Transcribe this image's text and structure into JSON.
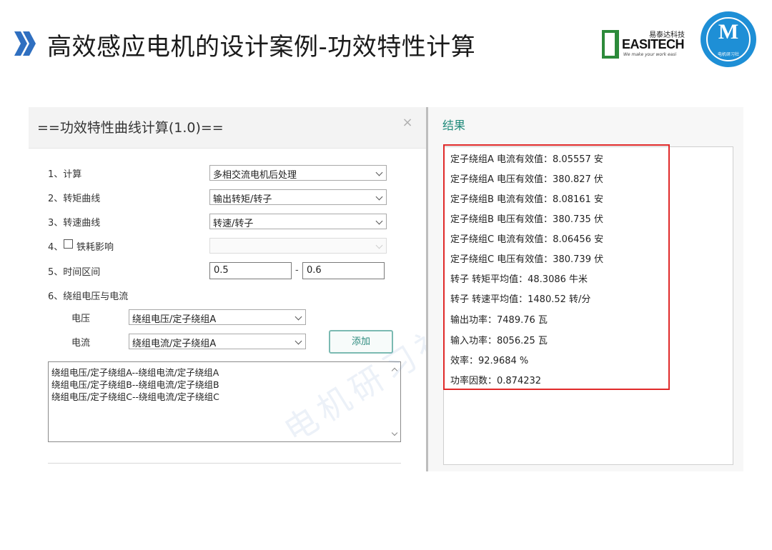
{
  "slide": {
    "title": "高效感应电机的设计案例-功效特性计算",
    "logo_easitech_cn": "易泰达科技",
    "logo_easitech_en": "EASITECH",
    "logo_easitech_tagline": "We make your work easi",
    "logo_circle_letter": "M",
    "logo_circle_sub": "电机研习社"
  },
  "dialog": {
    "title": "==功效特性曲线计算(1.0)==",
    "close_glyph": "×",
    "rows": {
      "calc_label": "1、计算",
      "calc_value": "多相交流电机后处理",
      "torque_label": "2、转矩曲线",
      "torque_value": "输出转矩/转子",
      "speed_label": "3、转速曲线",
      "speed_value": "转速/转子",
      "iron_label_prefix": "4、",
      "iron_label": "铁耗影响",
      "iron_checked": false,
      "time_label": "5、时间区间",
      "time_start": "0.5",
      "time_dash": "-",
      "time_end": "0.6",
      "winding_label": "6、绕组电压与电流",
      "voltage_label": "电压",
      "voltage_value": "绕组电压/定子绕组A",
      "current_label": "电流",
      "current_value": "绕组电流/定子绕组A",
      "add_label": "添加"
    },
    "list_items": [
      "绕组电压/定子绕组A--绕组电流/定子绕组A",
      "绕组电压/定子绕组B--绕组电流/定子绕组B",
      "绕组电压/定子绕组C--绕组电流/定子绕组C"
    ]
  },
  "watermark": "电机研习社",
  "results": {
    "title": "结果",
    "lines": [
      "定子绕组A 电流有效值：8.05557 安",
      "定子绕组A 电压有效值：380.827 伏",
      "定子绕组B 电流有效值：8.08161 安",
      "定子绕组B 电压有效值：380.735 伏",
      "定子绕组C 电流有效值：8.06456 安",
      "定子绕组C 电压有效值：380.739 伏",
      "转子 转矩平均值：48.3086 牛米",
      "转子 转速平均值：1480.52 转/分",
      "输出功率：7489.76 瓦",
      "输入功率：8056.25 瓦",
      "效率：92.9684 %",
      "功率因数：0.874232"
    ],
    "highlight_color": "#e02a2a"
  },
  "colors": {
    "accent_blue": "#2f6fc0",
    "teal": "#1f8a7a",
    "brand_green": "#2c8a3a",
    "brand_blue": "#1e8fd6"
  }
}
